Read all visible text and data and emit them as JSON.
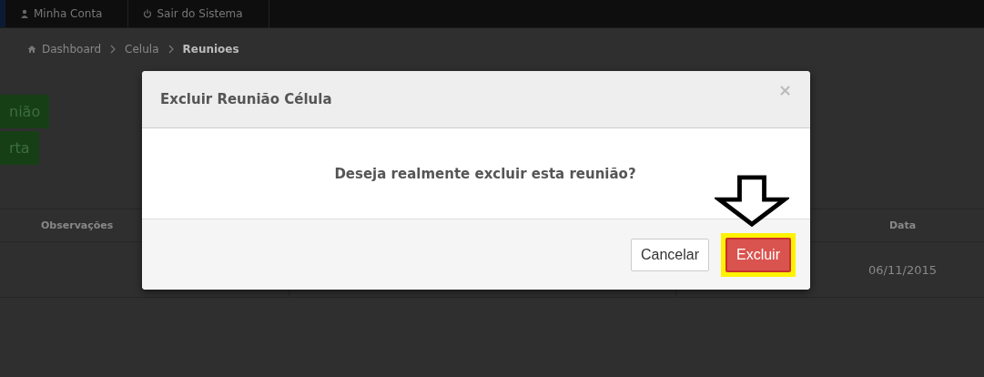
{
  "navbar": {
    "items": [
      {
        "label": "Minha Conta"
      },
      {
        "label": "Sair do Sistema"
      }
    ]
  },
  "breadcrumb": [
    {
      "label": "Dashboard",
      "selected": false
    },
    {
      "label": "Celula",
      "selected": false
    },
    {
      "label": "Reunioes",
      "selected": true
    }
  ],
  "action_buttons": [
    "nião",
    "rta"
  ],
  "table": {
    "columns": [
      "Observações",
      "Data"
    ],
    "rows": [
      {
        "data": "06/11/2015"
      }
    ]
  },
  "modal": {
    "title": "Excluir Reunião Célula",
    "close": "×",
    "message": "Deseja realmente excluir esta reunião?",
    "buttons": [
      {
        "label": "Cancelar",
        "kind": "default",
        "highlighted": false
      },
      {
        "label": "Excluir",
        "kind": "danger",
        "highlighted": true
      }
    ]
  }
}
